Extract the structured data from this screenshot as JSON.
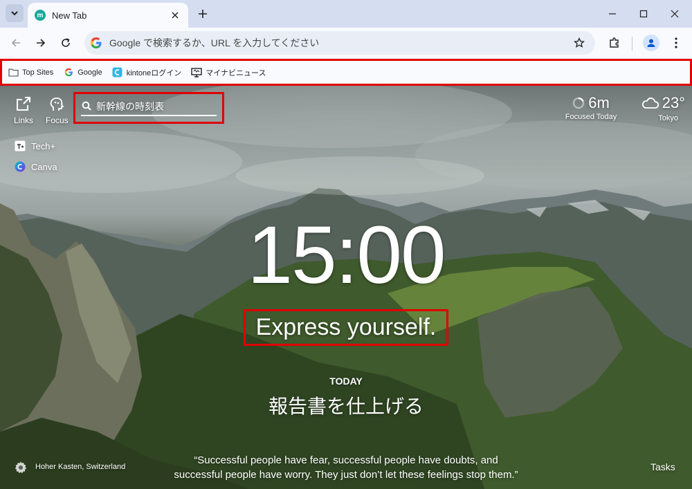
{
  "browser": {
    "tab_title": "New Tab",
    "tab_favicon_letter": "m",
    "omnibox_placeholder": "Google で検索するか、URL を入力してください",
    "omnibox_g": "G"
  },
  "bookmarks": [
    {
      "label": "Top Sites",
      "icon": "folder-icon"
    },
    {
      "label": "Google",
      "icon": "google-icon"
    },
    {
      "label": "kintoneログイン",
      "icon": "kintone-icon"
    },
    {
      "label": "マイナビニュース",
      "icon": "news-icon"
    }
  ],
  "momentum": {
    "links_label": "Links",
    "focus_label": "Focus",
    "search_value": "新幹線の時刻表",
    "shortcuts": [
      {
        "label": "Tech+",
        "icon": "techplus-icon"
      },
      {
        "label": "Canva",
        "icon": "canva-icon"
      }
    ],
    "focused_time": "6m",
    "focused_label": "Focused Today",
    "temperature": "23°",
    "city": "Tokyo",
    "clock": "15:00",
    "mantra": "Express yourself.",
    "today_label": "TODAY",
    "today_focus": "報告書を仕上げる",
    "photo_credit": "Hoher Kasten, Switzerland",
    "quote_line1": "“Successful people have fear, successful people have doubts, and",
    "quote_line2": "successful people have worry. They just don’t let these feelings stop them.”",
    "tasks_label": "Tasks"
  },
  "colors": {
    "highlight_border": "#e00000",
    "favicon": "#19a89b"
  }
}
